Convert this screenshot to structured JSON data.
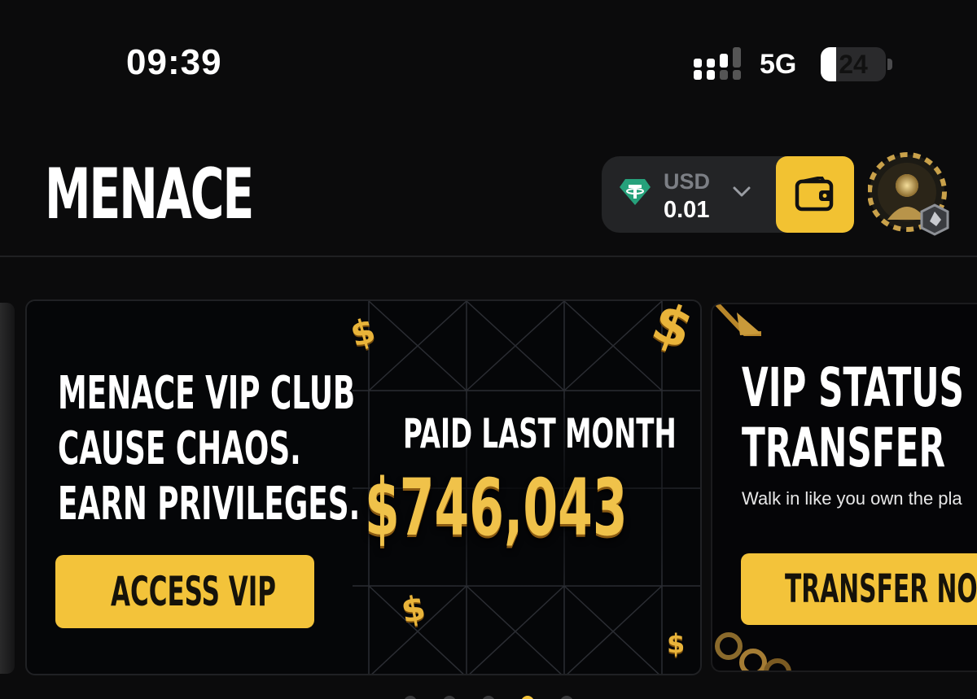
{
  "status_bar": {
    "time": "09:39",
    "network": "5G",
    "battery_percent": "24",
    "battery_level": 0.24
  },
  "header": {
    "logo": "MENACE",
    "balance": {
      "currency": "USD",
      "amount": "0.01",
      "currency_icon": "tether-icon"
    },
    "wallet_icon": "wallet-icon",
    "avatar_icon": "vip-avatar-icon"
  },
  "banners": [
    {
      "lines": [
        "MENACE  VIP CLUB",
        "CAUSE CHAOS.",
        "EARN PRIVILEGES."
      ],
      "stat_label": "PAID LAST MONTH",
      "stat_value": "$746,043",
      "button": "ACCESS VIP"
    },
    {
      "title_lines": [
        "VIP STATUS",
        "TRANSFER"
      ],
      "subtitle": "Walk in like you own the pla",
      "button": "TRANSFER NOW"
    }
  ],
  "colors": {
    "accent": "#f3c33a",
    "background": "#0b0b0c",
    "pill": "#232426",
    "tether": "#26a17b"
  }
}
